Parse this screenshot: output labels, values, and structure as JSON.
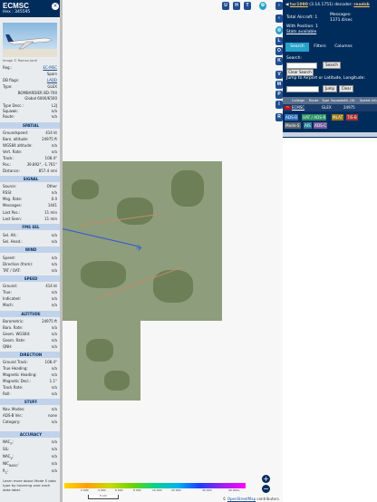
{
  "aircraft": {
    "callsign": "ECMSC",
    "hex_line": "Hex : 345595",
    "photo_credit": "Image © Ramon Jordi",
    "close_symbol": "×",
    "registration_label": "Reg.:",
    "registration": "EC-MSC",
    "country": "Spain",
    "db_flags_label": "DB flags:",
    "db_flags": "LADD",
    "type_label": "Type:",
    "type": "GLEX",
    "model_line1": "BOMBARDIER BD-700",
    "model_line2": "Global 6000/6500",
    "type_desc_label": "Type Desc.:",
    "type_desc": "L2J",
    "squawk_label": "Squawk:",
    "squawk": "n/a",
    "route_label": "Route:",
    "route": "n/a"
  },
  "sections": {
    "spatial": "SPATIAL",
    "signal": "SIGNAL",
    "fms_sel": "FMS SEL",
    "wind": "WIND",
    "speed": "SPEED",
    "altitude": "ALTITUDE",
    "direction": "DIRECTION",
    "stuff": "STUFF",
    "accuracy": "ACCURACY"
  },
  "spatial": [
    {
      "k": "Groundspeed:",
      "v": "414 kt"
    },
    {
      "k": "Baro. altitude:",
      "v": "24975 ft"
    },
    {
      "k": "WGS84 altitude:",
      "v": "n/a"
    },
    {
      "k": "Vert. Rate:",
      "v": "n/a"
    },
    {
      "k": "Track:",
      "v": "108.4°"
    },
    {
      "k": "Pos.:",
      "v": "39.892°, -1.761°"
    },
    {
      "k": "Distance:",
      "v": "857.4 nmi"
    }
  ],
  "signal": [
    {
      "k": "Source:",
      "v": "Other"
    },
    {
      "k": "RSSI:",
      "v": "n/a"
    },
    {
      "k": "Msg. Rate:",
      "v": "0.0"
    },
    {
      "k": "Messages:",
      "v": "1441"
    },
    {
      "k": "Last Pos.:",
      "v": "11 min"
    },
    {
      "k": "Last Seen:",
      "v": "11 min"
    }
  ],
  "fms": [
    {
      "k": "Sel. Alt.:",
      "v": "n/a"
    },
    {
      "k": "Sel. Head.:",
      "v": "n/a"
    }
  ],
  "wind": [
    {
      "k": "Speed:",
      "v": "n/a"
    },
    {
      "k": "Direction (from):",
      "v": "n/a"
    },
    {
      "k": "TAT / OAT:",
      "v": "n/a"
    }
  ],
  "speed": [
    {
      "k": "Ground:",
      "v": "414 kt"
    },
    {
      "k": "True:",
      "v": "n/a"
    },
    {
      "k": "Indicated:",
      "v": "n/a"
    },
    {
      "k": "Mach:",
      "v": "n/a"
    }
  ],
  "altitude": [
    {
      "k": "Barometric:",
      "v": "24975 ft"
    },
    {
      "k": "Baro. Rate:",
      "v": "n/a"
    },
    {
      "k": "Geom. WGS84:",
      "v": "n/a"
    },
    {
      "k": "Geom. Rate:",
      "v": "n/a"
    },
    {
      "k": "QNH:",
      "v": "n/a"
    }
  ],
  "direction": [
    {
      "k": "Ground Track:",
      "v": "108.4°"
    },
    {
      "k": "True Heading:",
      "v": "n/a"
    },
    {
      "k": "Magnetic Heading:",
      "v": "n/a"
    },
    {
      "k": "Magnetic Decl.:",
      "v": "1.1°"
    },
    {
      "k": "Track Rate:",
      "v": "n/a"
    },
    {
      "k": "Roll:",
      "v": "n/a"
    }
  ],
  "stuff": [
    {
      "k": "Nav. Modes:",
      "v": "n/a"
    },
    {
      "k": "ADS-B Ver.:",
      "v": "none"
    },
    {
      "k": "Category:",
      "v": "n/a"
    }
  ],
  "accuracy": [
    {
      "k": "NAC",
      "sub": "P",
      "v": "n/a"
    },
    {
      "k": "SIL:",
      "sub": "",
      "v": "n/a"
    },
    {
      "k": "NAC",
      "sub": "V",
      "v": "n/a"
    },
    {
      "k": "NIC",
      "sub": "BARO",
      "v": "n/a"
    },
    {
      "k": "R",
      "sub": "C",
      "v": "n/a"
    }
  ],
  "mode_s_note": "Learn more about Mode S data type by hovering over each data label.",
  "map": {
    "top_buttons": [
      "U",
      "H",
      "T"
    ],
    "side_buttons": [
      "L",
      "O",
      "K",
      "V",
      "M",
      "P",
      "I",
      "R"
    ],
    "legend_labels": [
      "2 000",
      "4 000",
      "6 000",
      "8 000",
      "10 000",
      "20 000",
      "30 000",
      "40 000+"
    ],
    "scale_label": "5 nm",
    "attribution_prefix": "© ",
    "attribution_link": "OpenStreetMap",
    "attribution_suffix": " contributors.",
    "zoom_in": "+",
    "zoom_out": "−",
    "plane_symbol": "✈",
    "colors": {
      "terrain": "#8e9d7b",
      "track": "#2a54e0",
      "plane": "#2f60d6"
    }
  },
  "panel": {
    "version_prefix": "◀ ",
    "version_link": "tar1090",
    "version_text": " (3.14.1751) decoder: ",
    "decoder_link": "readsb",
    "total_aircraft": "Total Aircraft: 1",
    "messages_label": "Messages:",
    "messages_value": "1371.4/sec",
    "with_position": "With Position: 1",
    "stats_link": "Stats available",
    "tabs": [
      "Search",
      "Filters",
      "Columns"
    ],
    "search_label": "Search:",
    "search_button": "Search",
    "clear_search_button": "Clear Search",
    "jump_label": "Jump to Airport or Latitude, Longitude:",
    "jump_button": "Jump",
    "clear_button": "Clear",
    "columns": [
      "Callsign",
      "Route",
      "Type",
      "Squawk",
      "Alt. (ft)",
      "Speed (kt)"
    ],
    "row": {
      "flag": "ES",
      "callsign": "ECMSC",
      "type": "GLEX",
      "altitude": "24975"
    },
    "chips": [
      {
        "label": "ADS-B",
        "color": "#2f6db5"
      },
      {
        "label": "UAT / ADS-R",
        "color": "#2c8f64"
      },
      {
        "label": "MLAT",
        "color": "#9a7a16"
      },
      {
        "label": "TIS-B",
        "color": "#a83232"
      },
      {
        "label": "Mode-S",
        "color": "#5c6570"
      },
      {
        "label": "AIS",
        "color": "#2c7f95"
      },
      {
        "label": "ADS-C",
        "color": "#7a5c9e"
      }
    ]
  }
}
